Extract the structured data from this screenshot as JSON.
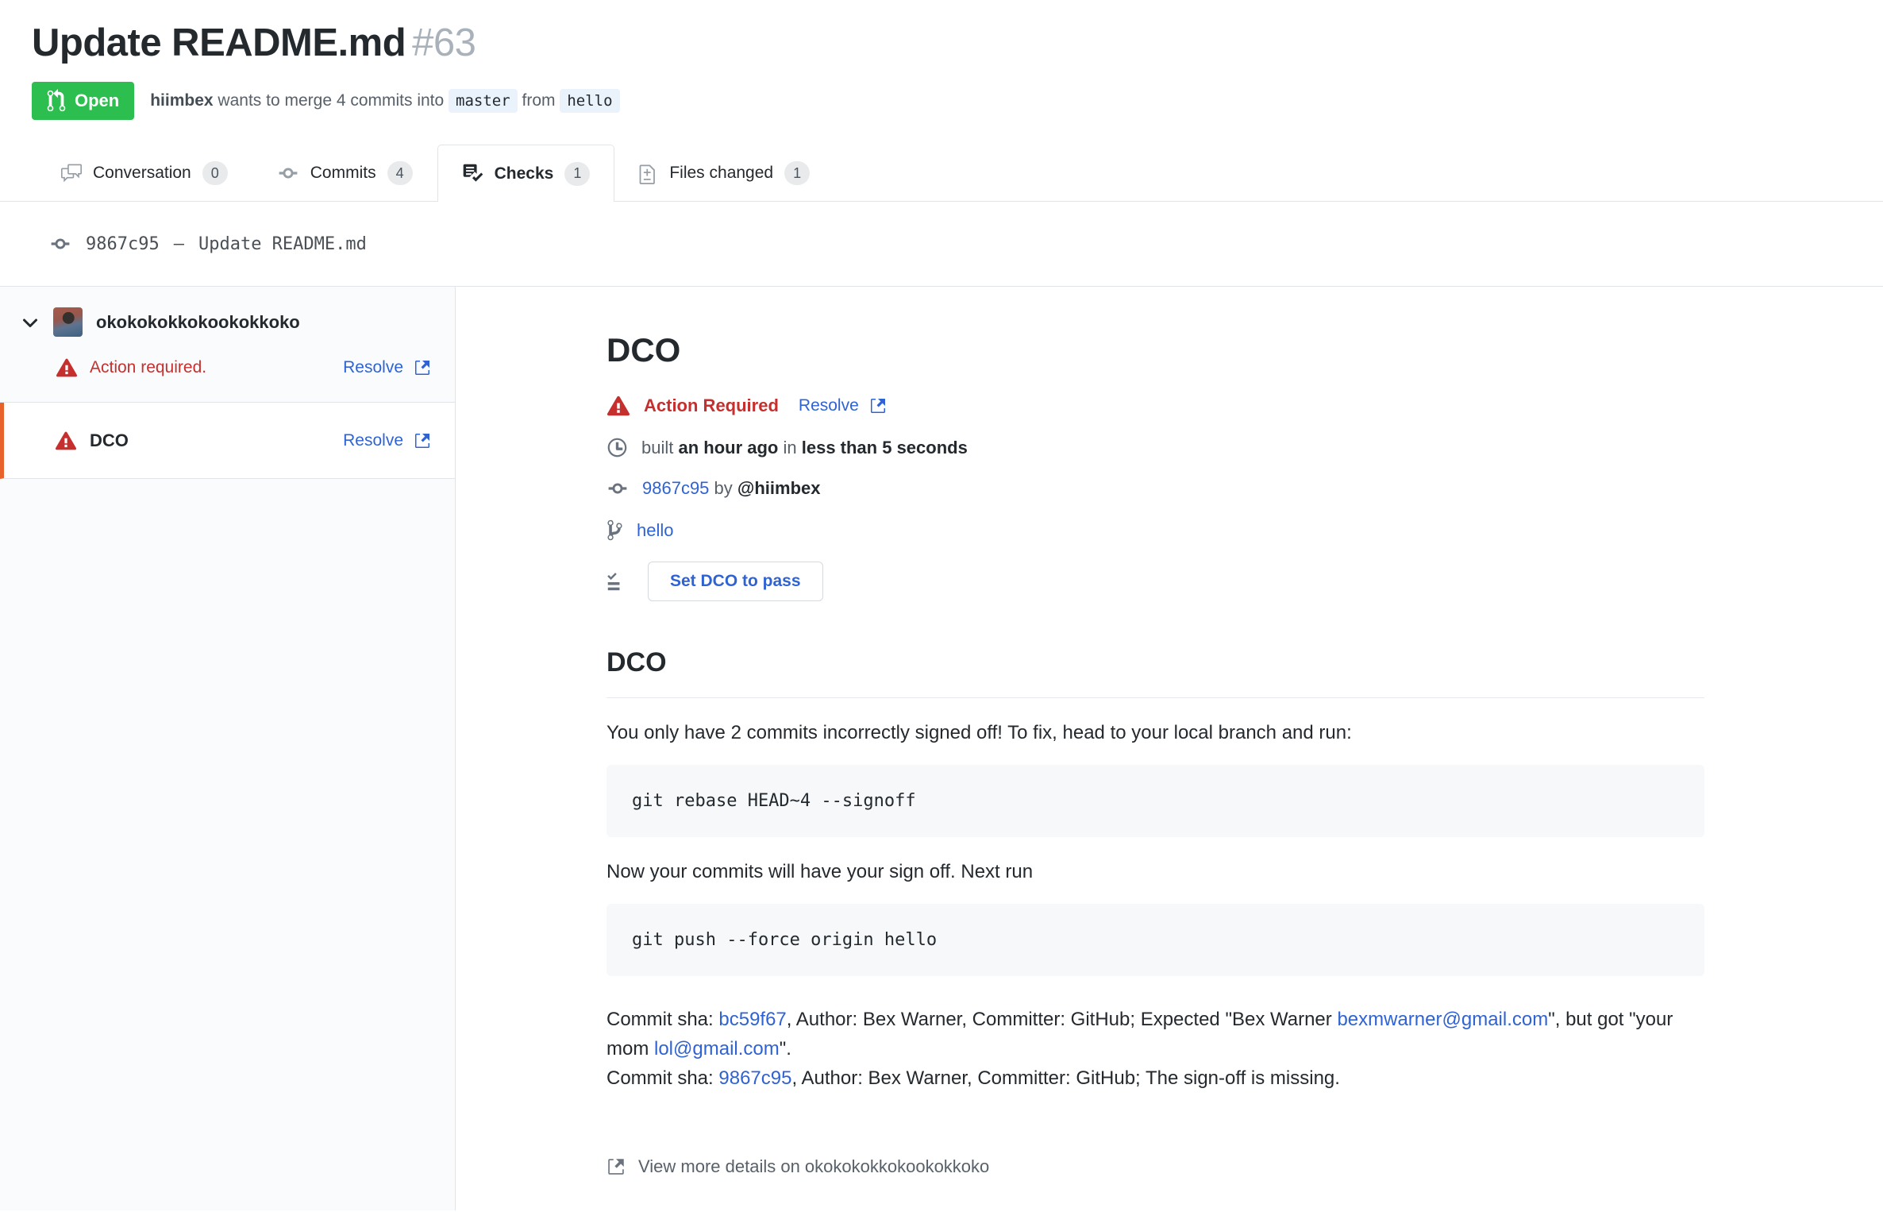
{
  "colors": {
    "open_green": "#2cbe4e",
    "danger_red": "#c5302e",
    "accent_blue": "#2f63d4",
    "active_item_orange": "#e8632c",
    "sidebar_bg": "#fafbfc",
    "code_bg": "#f6f8fa",
    "border": "#e1e4e8"
  },
  "icons": {
    "state": "git-pull-request",
    "tab_conversation": "comment-discussion",
    "tab_commits": "git-commit",
    "tab_checks": "checklist",
    "tab_files": "diff",
    "status": "warning-triangle",
    "resolve": "link-external",
    "time": "clock",
    "branch": "git-branch",
    "action": "tasklist",
    "footer": "link-external"
  },
  "header": {
    "title": "Update README.md",
    "number": "#63",
    "state_label": "Open",
    "byline": {
      "author": "hiimbex",
      "middle": " wants to merge 4 commits into ",
      "base_branch": "master",
      "from": " from ",
      "head_branch": "hello"
    }
  },
  "tabs": [
    {
      "label": "Conversation",
      "count": "0"
    },
    {
      "label": "Commits",
      "count": "4"
    },
    {
      "label": "Checks",
      "count": "1"
    },
    {
      "label": "Files changed",
      "count": "1"
    }
  ],
  "commit_bar": {
    "sha": "9867c95",
    "separator": "—",
    "message": "Update README.md"
  },
  "sidebar": {
    "suite": {
      "name": "okokokokkokookokkoko",
      "status": "Action required.",
      "resolve_label": "Resolve"
    },
    "items": [
      {
        "label": "DCO",
        "resolve_label": "Resolve"
      }
    ]
  },
  "main": {
    "title": "DCO",
    "status": {
      "label": "Action Required",
      "resolve_label": "Resolve"
    },
    "built": {
      "pre": "built ",
      "time": "an hour ago",
      "mid": " in ",
      "duration": "less than 5 seconds"
    },
    "commit": {
      "sha": "9867c95",
      "by": " by ",
      "author": "@hiimbex"
    },
    "branch": "hello",
    "action_button": "Set DCO to pass",
    "section": {
      "heading": "DCO",
      "p1": "You only have 2 commits incorrectly signed off! To fix, head to your local branch and run:",
      "code1": "git rebase HEAD~4 --signoff",
      "p2": "Now your commits will have your sign off. Next run",
      "code2": "git push --force origin hello",
      "sha_line1": {
        "pre": "Commit sha: ",
        "sha": "bc59f67",
        "mid": ", Author: Bex Warner, Committer: GitHub; Expected \"Bex Warner ",
        "email": "bexmwarner@gmail.com",
        "post": "\", but got \"your mom ",
        "email2": "lol@gmail.com",
        "end": "\"."
      },
      "sha_line2": {
        "pre": "Commit sha: ",
        "sha": "9867c95",
        "post": ", Author: Bex Warner, Committer: GitHub; The sign-off is missing."
      }
    },
    "footer": "View more details on okokokokkokookokkoko"
  }
}
